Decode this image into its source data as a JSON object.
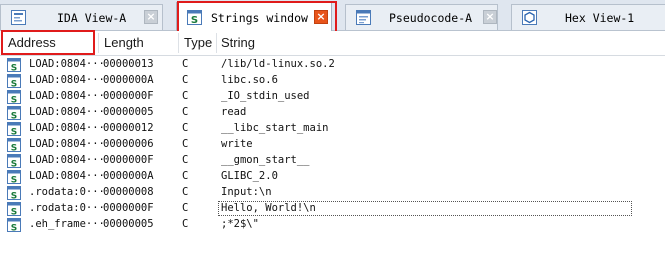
{
  "tabs": [
    {
      "label": "IDA View-A",
      "icon": "ida-view-icon",
      "active": false
    },
    {
      "label": "Strings window",
      "icon": "strings-icon",
      "active": true
    },
    {
      "label": "Pseudocode-A",
      "icon": "pseudocode-icon",
      "active": false
    },
    {
      "label": "Hex View-1",
      "icon": "hex-view-icon",
      "active": false
    }
  ],
  "close_glyph": "×",
  "columns": {
    "address": "Address",
    "length": "Length",
    "type": "Type",
    "string": "String"
  },
  "colors": {
    "accent": "#e01b1b",
    "close_active": "#e8541a",
    "string_icon": "#1a7a3a"
  },
  "rows": [
    {
      "address": "LOAD:0804···",
      "length": "00000013",
      "type": "C",
      "string": "/lib/ld-linux.so.2"
    },
    {
      "address": "LOAD:0804···",
      "length": "0000000A",
      "type": "C",
      "string": "libc.so.6"
    },
    {
      "address": "LOAD:0804···",
      "length": "0000000F",
      "type": "C",
      "string": "_IO_stdin_used"
    },
    {
      "address": "LOAD:0804···",
      "length": "00000005",
      "type": "C",
      "string": "read"
    },
    {
      "address": "LOAD:0804···",
      "length": "00000012",
      "type": "C",
      "string": "__libc_start_main"
    },
    {
      "address": "LOAD:0804···",
      "length": "00000006",
      "type": "C",
      "string": "write"
    },
    {
      "address": "LOAD:0804···",
      "length": "0000000F",
      "type": "C",
      "string": "__gmon_start__"
    },
    {
      "address": "LOAD:0804···",
      "length": "0000000A",
      "type": "C",
      "string": "GLIBC_2.0"
    },
    {
      "address": ".rodata:0···",
      "length": "00000008",
      "type": "C",
      "string": "Input:\\n"
    },
    {
      "address": ".rodata:0···",
      "length": "0000000F",
      "type": "C",
      "string": "Hello, World!\\n"
    },
    {
      "address": ".eh_frame···",
      "length": "00000005",
      "type": "C",
      "string": ";*2$\\\""
    }
  ],
  "selected_row": 9
}
